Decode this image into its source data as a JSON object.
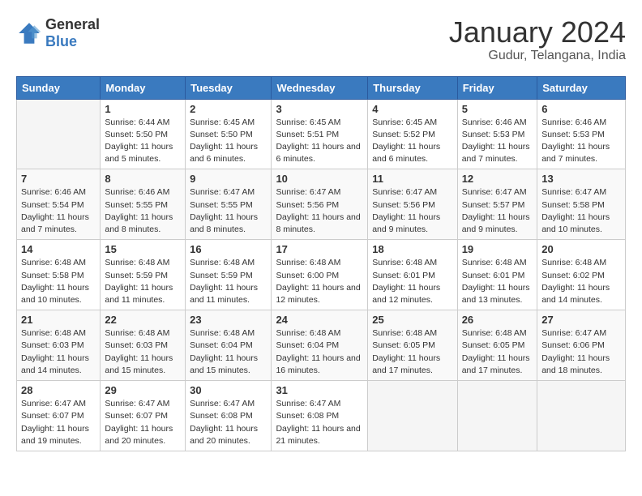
{
  "logo": {
    "general": "General",
    "blue": "Blue"
  },
  "title": "January 2024",
  "subtitle": "Gudur, Telangana, India",
  "days_of_week": [
    "Sunday",
    "Monday",
    "Tuesday",
    "Wednesday",
    "Thursday",
    "Friday",
    "Saturday"
  ],
  "weeks": [
    [
      {
        "day": "",
        "sunrise": "",
        "sunset": "",
        "daylight": ""
      },
      {
        "day": "1",
        "sunrise": "6:44 AM",
        "sunset": "5:50 PM",
        "daylight": "11 hours and 5 minutes."
      },
      {
        "day": "2",
        "sunrise": "6:45 AM",
        "sunset": "5:50 PM",
        "daylight": "11 hours and 6 minutes."
      },
      {
        "day": "3",
        "sunrise": "6:45 AM",
        "sunset": "5:51 PM",
        "daylight": "11 hours and 6 minutes."
      },
      {
        "day": "4",
        "sunrise": "6:45 AM",
        "sunset": "5:52 PM",
        "daylight": "11 hours and 6 minutes."
      },
      {
        "day": "5",
        "sunrise": "6:46 AM",
        "sunset": "5:53 PM",
        "daylight": "11 hours and 7 minutes."
      },
      {
        "day": "6",
        "sunrise": "6:46 AM",
        "sunset": "5:53 PM",
        "daylight": "11 hours and 7 minutes."
      }
    ],
    [
      {
        "day": "7",
        "sunrise": "6:46 AM",
        "sunset": "5:54 PM",
        "daylight": "11 hours and 7 minutes."
      },
      {
        "day": "8",
        "sunrise": "6:46 AM",
        "sunset": "5:55 PM",
        "daylight": "11 hours and 8 minutes."
      },
      {
        "day": "9",
        "sunrise": "6:47 AM",
        "sunset": "5:55 PM",
        "daylight": "11 hours and 8 minutes."
      },
      {
        "day": "10",
        "sunrise": "6:47 AM",
        "sunset": "5:56 PM",
        "daylight": "11 hours and 8 minutes."
      },
      {
        "day": "11",
        "sunrise": "6:47 AM",
        "sunset": "5:56 PM",
        "daylight": "11 hours and 9 minutes."
      },
      {
        "day": "12",
        "sunrise": "6:47 AM",
        "sunset": "5:57 PM",
        "daylight": "11 hours and 9 minutes."
      },
      {
        "day": "13",
        "sunrise": "6:47 AM",
        "sunset": "5:58 PM",
        "daylight": "11 hours and 10 minutes."
      }
    ],
    [
      {
        "day": "14",
        "sunrise": "6:48 AM",
        "sunset": "5:58 PM",
        "daylight": "11 hours and 10 minutes."
      },
      {
        "day": "15",
        "sunrise": "6:48 AM",
        "sunset": "5:59 PM",
        "daylight": "11 hours and 11 minutes."
      },
      {
        "day": "16",
        "sunrise": "6:48 AM",
        "sunset": "5:59 PM",
        "daylight": "11 hours and 11 minutes."
      },
      {
        "day": "17",
        "sunrise": "6:48 AM",
        "sunset": "6:00 PM",
        "daylight": "11 hours and 12 minutes."
      },
      {
        "day": "18",
        "sunrise": "6:48 AM",
        "sunset": "6:01 PM",
        "daylight": "11 hours and 12 minutes."
      },
      {
        "day": "19",
        "sunrise": "6:48 AM",
        "sunset": "6:01 PM",
        "daylight": "11 hours and 13 minutes."
      },
      {
        "day": "20",
        "sunrise": "6:48 AM",
        "sunset": "6:02 PM",
        "daylight": "11 hours and 14 minutes."
      }
    ],
    [
      {
        "day": "21",
        "sunrise": "6:48 AM",
        "sunset": "6:03 PM",
        "daylight": "11 hours and 14 minutes."
      },
      {
        "day": "22",
        "sunrise": "6:48 AM",
        "sunset": "6:03 PM",
        "daylight": "11 hours and 15 minutes."
      },
      {
        "day": "23",
        "sunrise": "6:48 AM",
        "sunset": "6:04 PM",
        "daylight": "11 hours and 15 minutes."
      },
      {
        "day": "24",
        "sunrise": "6:48 AM",
        "sunset": "6:04 PM",
        "daylight": "11 hours and 16 minutes."
      },
      {
        "day": "25",
        "sunrise": "6:48 AM",
        "sunset": "6:05 PM",
        "daylight": "11 hours and 17 minutes."
      },
      {
        "day": "26",
        "sunrise": "6:48 AM",
        "sunset": "6:05 PM",
        "daylight": "11 hours and 17 minutes."
      },
      {
        "day": "27",
        "sunrise": "6:47 AM",
        "sunset": "6:06 PM",
        "daylight": "11 hours and 18 minutes."
      }
    ],
    [
      {
        "day": "28",
        "sunrise": "6:47 AM",
        "sunset": "6:07 PM",
        "daylight": "11 hours and 19 minutes."
      },
      {
        "day": "29",
        "sunrise": "6:47 AM",
        "sunset": "6:07 PM",
        "daylight": "11 hours and 20 minutes."
      },
      {
        "day": "30",
        "sunrise": "6:47 AM",
        "sunset": "6:08 PM",
        "daylight": "11 hours and 20 minutes."
      },
      {
        "day": "31",
        "sunrise": "6:47 AM",
        "sunset": "6:08 PM",
        "daylight": "11 hours and 21 minutes."
      },
      {
        "day": "",
        "sunrise": "",
        "sunset": "",
        "daylight": ""
      },
      {
        "day": "",
        "sunrise": "",
        "sunset": "",
        "daylight": ""
      },
      {
        "day": "",
        "sunrise": "",
        "sunset": "",
        "daylight": ""
      }
    ]
  ],
  "labels": {
    "sunrise": "Sunrise:",
    "sunset": "Sunset:",
    "daylight": "Daylight:"
  }
}
